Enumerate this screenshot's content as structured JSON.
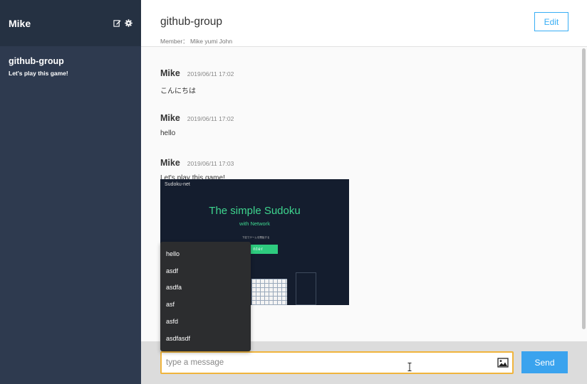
{
  "sidebar": {
    "user_name": "Mike",
    "groups": [
      {
        "name": "github-group",
        "last_message": "Let's play this game!"
      }
    ]
  },
  "chat": {
    "title": "github-group",
    "members": "Member： Mike yumi John",
    "edit_label": "Edit",
    "messages": [
      {
        "user": "Mike",
        "time": "2019/06/11 17:02",
        "text": "こんにちは"
      },
      {
        "user": "Mike",
        "time": "2019/06/11 17:02",
        "text": "hello"
      },
      {
        "user": "Mike",
        "time": "2019/06/11 17:03",
        "text": "Let's play this game!",
        "image": {
          "brand": "Sudoku-net",
          "title": "The simple Sudoku",
          "subtitle": "with Network",
          "caption": "下記でゲームを開始する",
          "button": "nter"
        }
      }
    ]
  },
  "composer": {
    "placeholder": "type a message",
    "send_label": "Send"
  },
  "autocomplete": {
    "items": [
      "hello",
      "asdf",
      "asdfa",
      "asf",
      "asfd",
      "asdfasdf"
    ]
  },
  "colors": {
    "sidebar_bg": "#2e3a4f",
    "sidebar_header_bg": "#253142",
    "accent": "#3aa3ee",
    "input_focus": "#f0b43c",
    "sudoku_green": "#3ed68f"
  },
  "icons": [
    "edit-icon",
    "gear-icon",
    "image-icon",
    "text-cursor-icon"
  ]
}
